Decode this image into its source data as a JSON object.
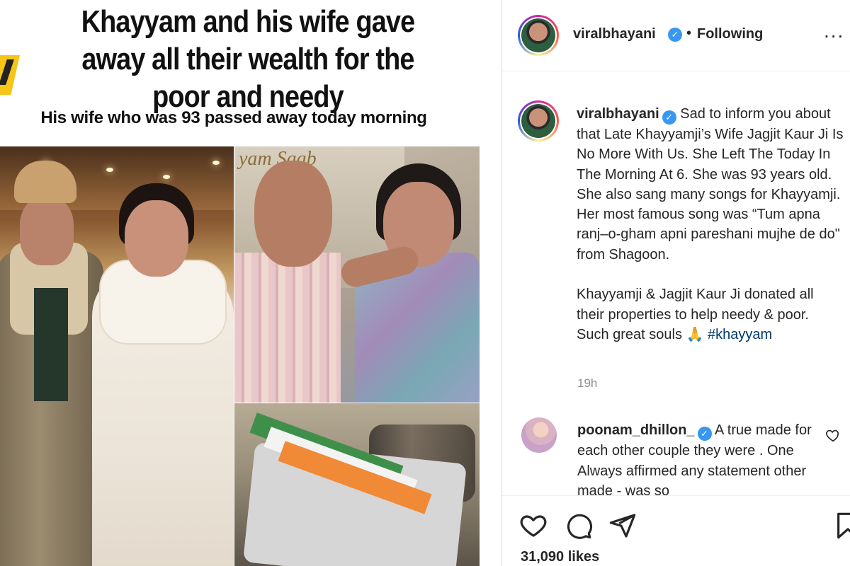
{
  "post_image": {
    "headline": "Khayyam and his wife  gave away all their wealth for the poor and needy",
    "subline": "His wife who was 93 passed away today morning",
    "poster_text": "yam Saab"
  },
  "header": {
    "username": "viralbhayani",
    "verified": "✓",
    "separator": "•",
    "follow_state": "Following",
    "more": "..."
  },
  "caption": {
    "username": "viralbhayani",
    "verified": "✓",
    "text": "Sad to inform you about that Late Khayyamji’s Wife Jagjit Kaur Ji Is No More With Us. She Left The Today In The Morning At 6. She was 93 years old. She also sang many songs for Khayyamji. Her most famous song was “Tum apna ranj–o-gham apni pareshani mujhe de do\" from Shagoon.\n\nKhayyamji & Jagjit Kaur Ji donated all their properties to help needy & poor. Such great souls 🙏 ",
    "hashtag": "#khayyam",
    "timestamp": "19h"
  },
  "comment": {
    "username": "poonam_dhillon_",
    "verified": "✓",
    "text": "A true made for each other couple they were . One Always affirmed any statement other made - was so"
  },
  "actions": {
    "icons": [
      "heart-icon",
      "comment-icon",
      "share-icon",
      "bookmark-icon"
    ],
    "likes": "31,090 likes"
  },
  "colors": {
    "link": "#00376b",
    "verified": "#3897f0",
    "muted": "#8e8e8e",
    "text": "#262626"
  }
}
